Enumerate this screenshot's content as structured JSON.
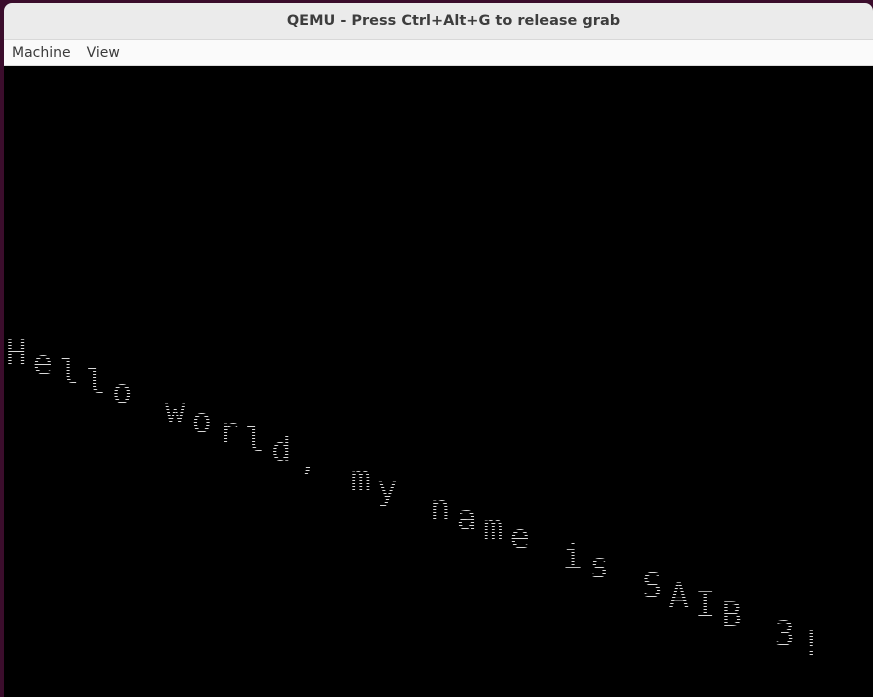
{
  "window": {
    "title": "QEMU - Press Ctrl+Alt+G to release grab"
  },
  "menubar": {
    "items": [
      {
        "label": "Machine"
      },
      {
        "label": "View"
      }
    ]
  },
  "screen": {
    "text": "Hello world, my name is SAIB_3!",
    "text_color": "#d9d9d9",
    "background_color": "#000000"
  }
}
